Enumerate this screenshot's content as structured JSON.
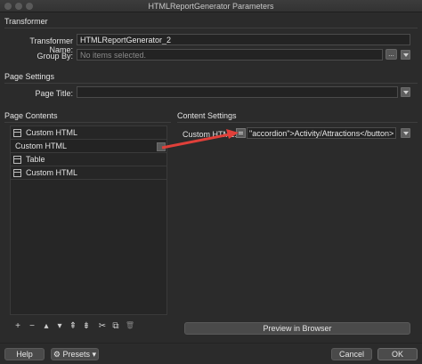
{
  "window": {
    "title": "HTMLReportGenerator Parameters"
  },
  "transformer": {
    "section_label": "Transformer",
    "name_label": "Transformer Name:",
    "name_value": "HTMLReportGenerator_2",
    "group_by_label": "Group By:",
    "group_by_placeholder": "No items selected.",
    "ellipsis": "..."
  },
  "page_settings": {
    "section_label": "Page Settings",
    "page_title_label": "Page Title:",
    "page_title_value": ""
  },
  "page_contents": {
    "section_label": "Page Contents",
    "items": [
      {
        "label": "Custom HTML",
        "icon": "document-icon"
      },
      {
        "label": "Custom HTML",
        "icon": "none"
      },
      {
        "label": "Table",
        "icon": "document-icon"
      },
      {
        "label": "Custom HTML",
        "icon": "document-icon"
      }
    ],
    "toolbar": [
      "+",
      "−",
      "▴",
      "▾",
      "⇞",
      "⇟",
      "✂",
      "⧉",
      "🗑"
    ]
  },
  "content_settings": {
    "section_label": "Content Settings",
    "custom_html_label": "Custom HTML:",
    "custom_html_value": "\"accordion\">Activity/Attractions</button> ...",
    "preview_button": "Preview in Browser"
  },
  "footer": {
    "help": "Help",
    "presets": "Presets",
    "cancel": "Cancel",
    "ok": "OK"
  },
  "colors": {
    "arrow": "#e0403a",
    "background": "#2b2b2b"
  }
}
